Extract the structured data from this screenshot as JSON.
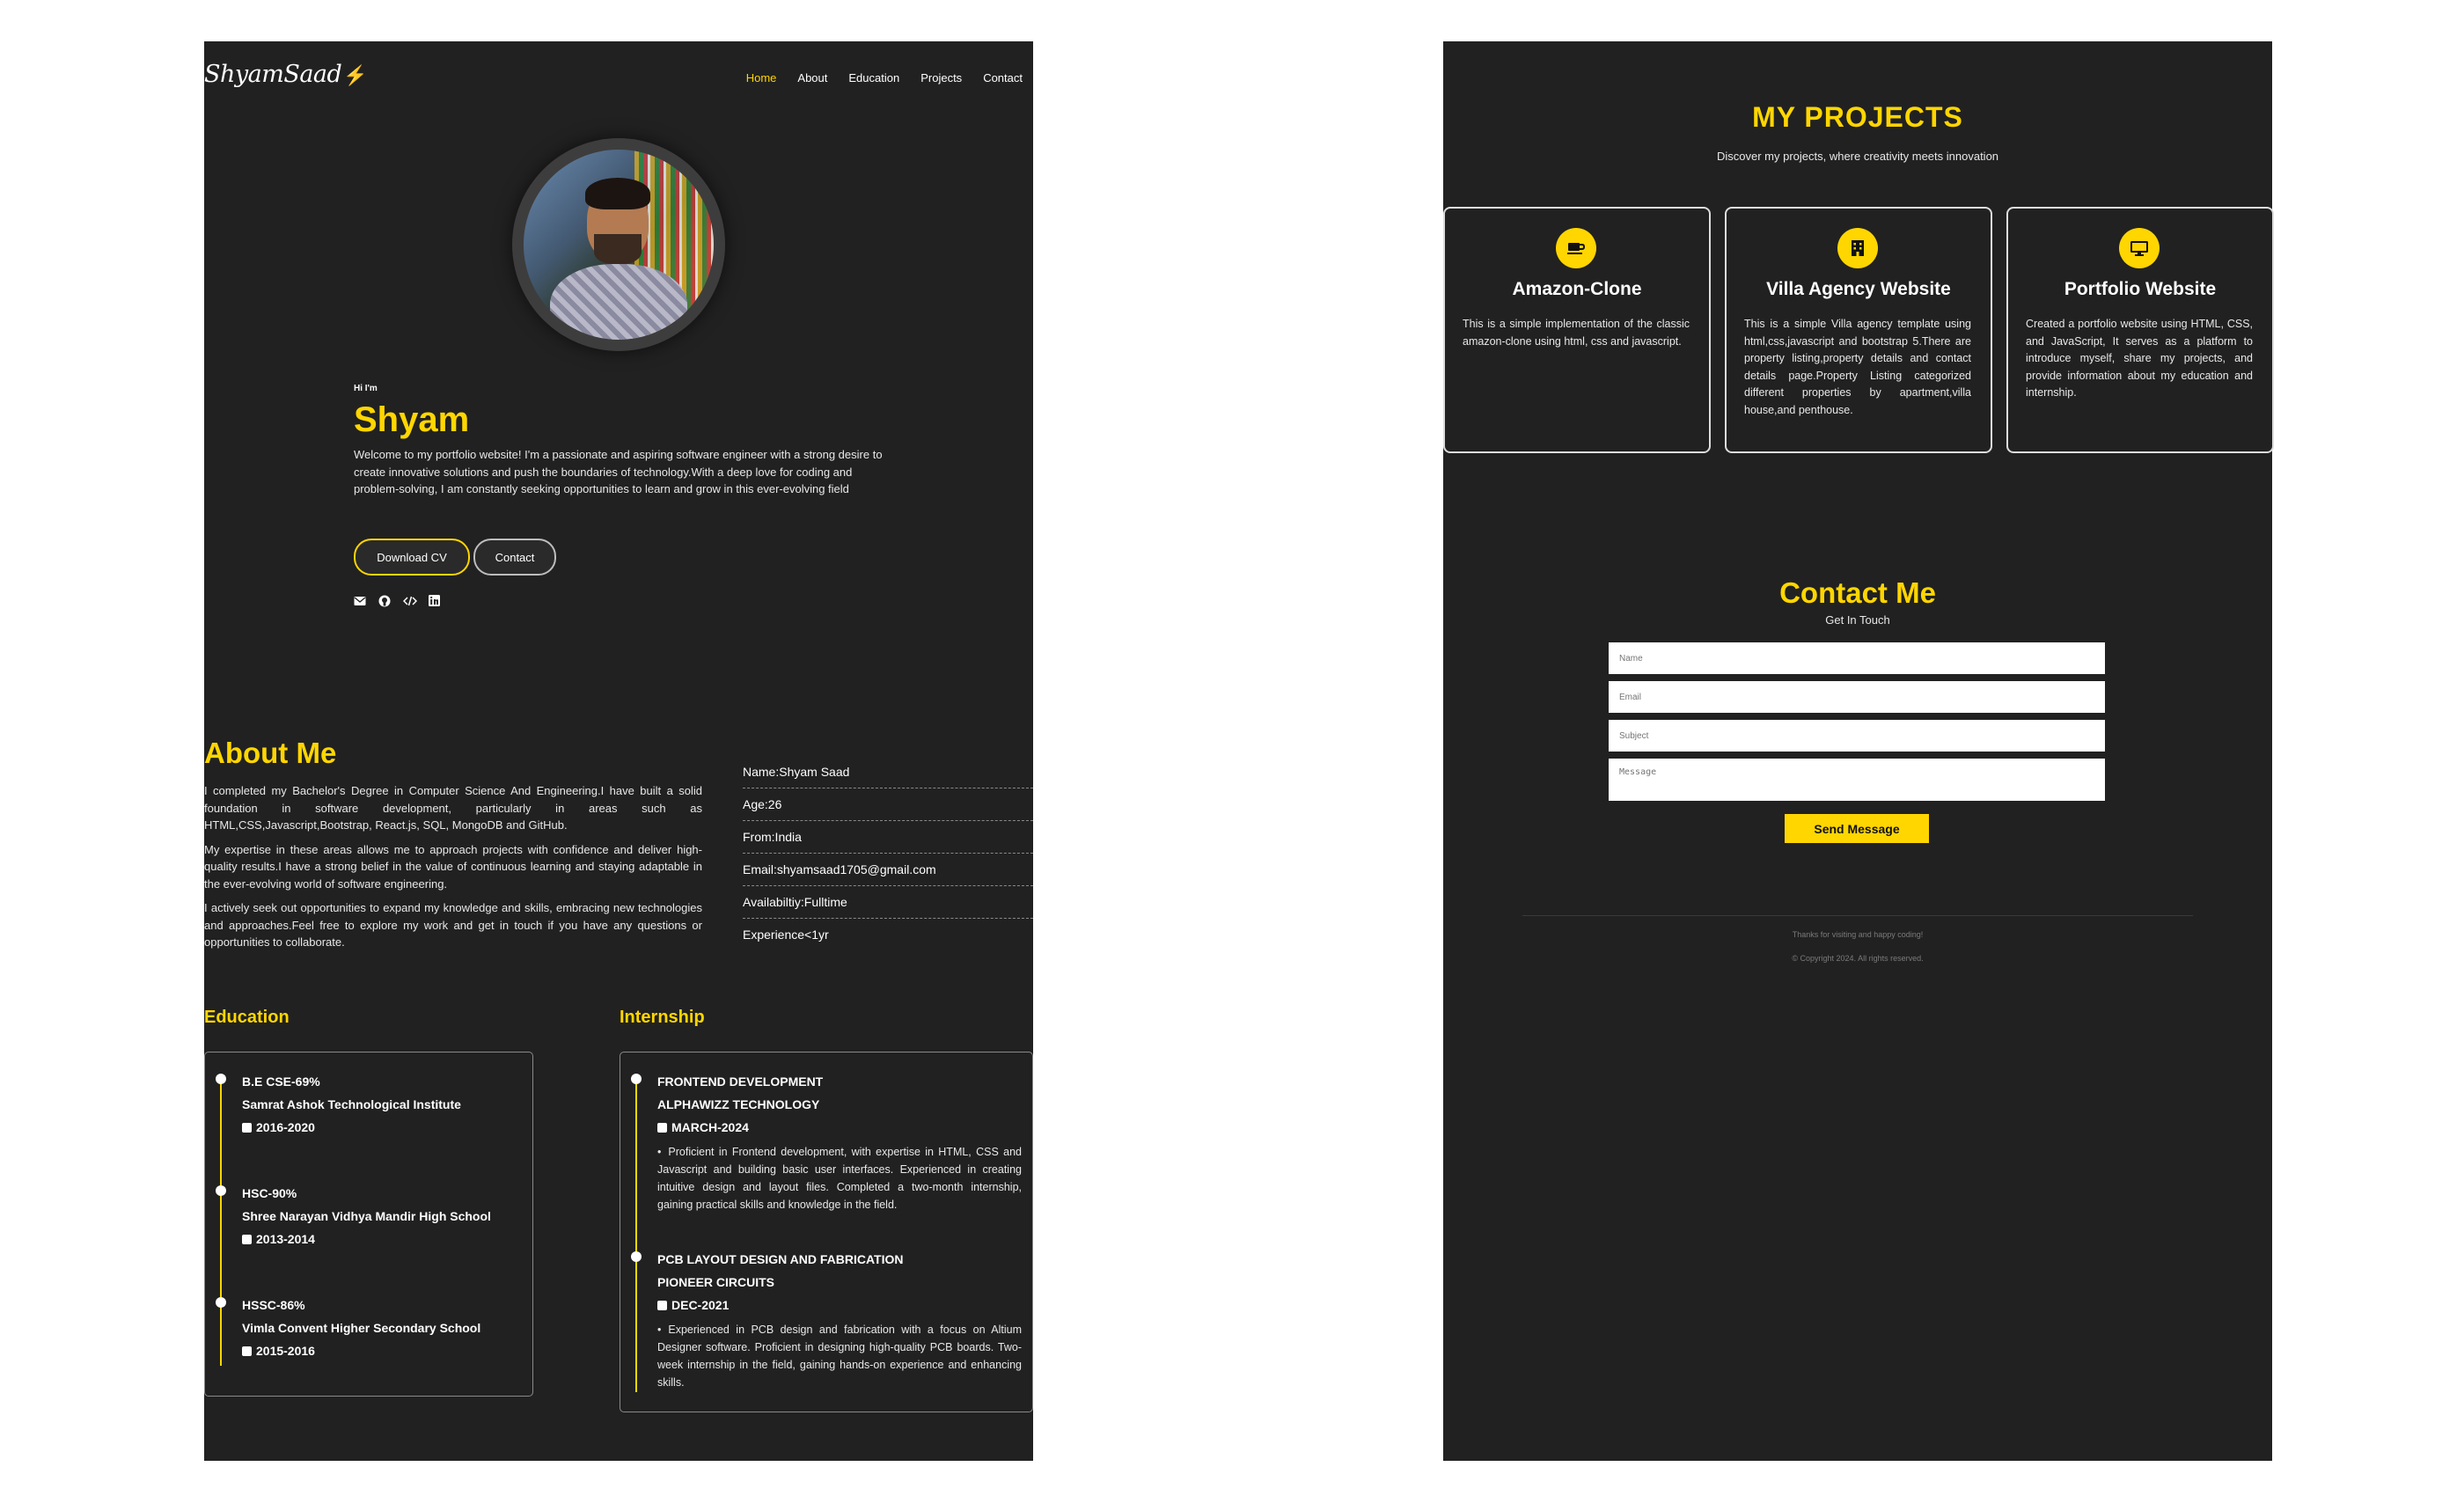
{
  "nav": {
    "logo": "ShyamSaad",
    "logo_bolt": "⚡",
    "items": [
      "Home",
      "About",
      "Education",
      "Projects",
      "Contact"
    ],
    "active_index": 0
  },
  "hero": {
    "greeting": "Hi I'm",
    "name": "Shyam",
    "intro": "Welcome to my portfolio website! I'm a passionate and aspiring software engineer with a strong desire to create innovative solutions and push the boundaries of technology.With a deep love for coding and problem-solving, I am constantly seeking opportunities to learn and grow in this ever-evolving field",
    "btn_cv": "Download CV",
    "btn_contact": "Contact",
    "socials": [
      "mail-icon",
      "github-icon",
      "code-icon",
      "linkedin-icon"
    ]
  },
  "about": {
    "title": "About Me",
    "paragraphs": [
      "I completed my Bachelor's Degree in Computer Science And Engineering.I have built a solid foundation in software development, particularly in areas such as HTML,CSS,Javascript,Bootstrap, React.js, SQL, MongoDB and GitHub.",
      "My expertise in these areas allows me to approach projects with confidence and deliver high-quality results.I have a strong belief in the value of continuous learning and staying adaptable in the ever-evolving world of software engineering.",
      "I actively seek out opportunities to expand my knowledge and skills, embracing new technologies and approaches.Feel free to explore my work and get in touch if you have any questions or opportunities to collaborate."
    ],
    "info": [
      "Name:Shyam Saad",
      "Age:26",
      "From:India",
      "Email:shyamsaad1705@gmail.com",
      "Availabiltiy:Fulltime",
      "Experience<1yr"
    ]
  },
  "education": {
    "title": "Education",
    "items": [
      {
        "degree": "B.E CSE-69%",
        "school": "Samrat Ashok Technological Institute",
        "years": "2016-2020"
      },
      {
        "degree": "HSC-90%",
        "school": "Shree Narayan Vidhya Mandir High School",
        "years": "2013-2014"
      },
      {
        "degree": "HSSC-86%",
        "school": "Vimla Convent Higher Secondary School",
        "years": "2015-2016"
      }
    ]
  },
  "internship": {
    "title": "Internship",
    "items": [
      {
        "role": "FRONTEND DEVELOPMENT",
        "company": "ALPHAWIZZ TECHNOLOGY",
        "date": "MARCH-2024",
        "desc": "Proficient in Frontend development, with expertise in HTML, CSS and Javascript and building basic user interfaces. Experienced in creating intuitive design and layout files. Completed a two-month internship, gaining practical skills and knowledge in the field."
      },
      {
        "role": "PCB LAYOUT DESIGN AND FABRICATION",
        "company": "PIONEER CIRCUITS",
        "date": "DEC-2021",
        "desc": "Experienced in PCB design and fabrication with a focus on Altium Designer software. Proficient in designing high-quality PCB boards. Two-week internship in the field, gaining hands-on experience and enhancing skills."
      }
    ]
  },
  "projects": {
    "title": "MY PROJECTS",
    "subtitle": "Discover my projects, where creativity meets innovation",
    "cards": [
      {
        "icon": "coffee-cup-icon",
        "title": "Amazon-Clone",
        "desc": "This is a simple implementation of the classic amazon-clone using html, css and javascript."
      },
      {
        "icon": "building-icon",
        "title": "Villa Agency Website",
        "desc": "This is a simple Villa agency template using html,css,javascript and bootstrap 5.There are property listing,property details and contact details page.Property Listing categorized different properties by apartment,villa house,and penthouse."
      },
      {
        "icon": "monitor-icon",
        "title": "Portfolio Website",
        "desc": "Created a portfolio website using HTML, CSS, and JavaScript, It serves as a platform to introduce myself, share my projects, and provide information about my education and internship."
      }
    ]
  },
  "contact": {
    "title": "Contact Me",
    "subtitle": "Get In Touch",
    "name_placeholder": "Name",
    "email_placeholder": "Email",
    "subject_placeholder": "Subject",
    "message_placeholder": "Message",
    "send_label": "Send Message"
  },
  "footer": {
    "thanks": "Thanks for visiting and happy coding!",
    "copyright": "© Copyright 2024. All rights reserved."
  },
  "colors": {
    "accent": "#FFD600",
    "panel_bg": "#212121",
    "page_bg": "#FFFFFF"
  }
}
